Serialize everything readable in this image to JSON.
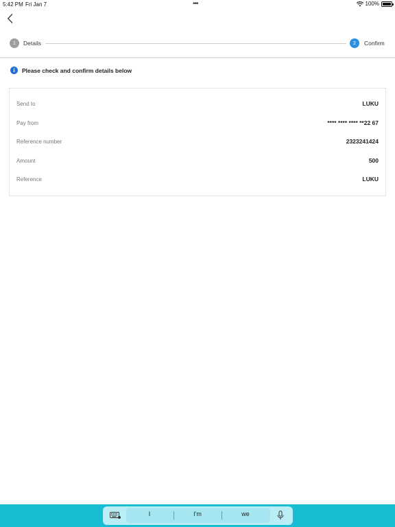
{
  "status_bar": {
    "time": "5:42 PM",
    "date": "Fri Jan 7",
    "dots": "•••",
    "battery": "100%",
    "icons": [
      "wifi-icon",
      "battery-icon"
    ]
  },
  "nav": {
    "back_icon": "chevron-left-icon"
  },
  "stepper": {
    "steps": [
      {
        "number": "1",
        "label": "Details"
      },
      {
        "number": "2",
        "label": "Confirm"
      }
    ],
    "colors": {
      "inactive": "#9e9e9e",
      "active": "#2b8fe0"
    }
  },
  "notice": {
    "icon": "info-icon",
    "text": "Please check and confirm details below"
  },
  "details": {
    "rows": [
      {
        "label": "Send to",
        "value": "LUKU"
      },
      {
        "label": "Pay from",
        "value": "**** **** **** **22 67"
      },
      {
        "label": "Reference number",
        "value": "2323241424"
      },
      {
        "label": "Amount",
        "value": "500"
      },
      {
        "label": "Reference",
        "value": "LUKU"
      }
    ]
  },
  "keyboard": {
    "suggestions": [
      "I",
      "I'm",
      "we"
    ],
    "icons": [
      "keyboard-icon",
      "microphone-icon"
    ],
    "accent": "#18bdd4"
  }
}
